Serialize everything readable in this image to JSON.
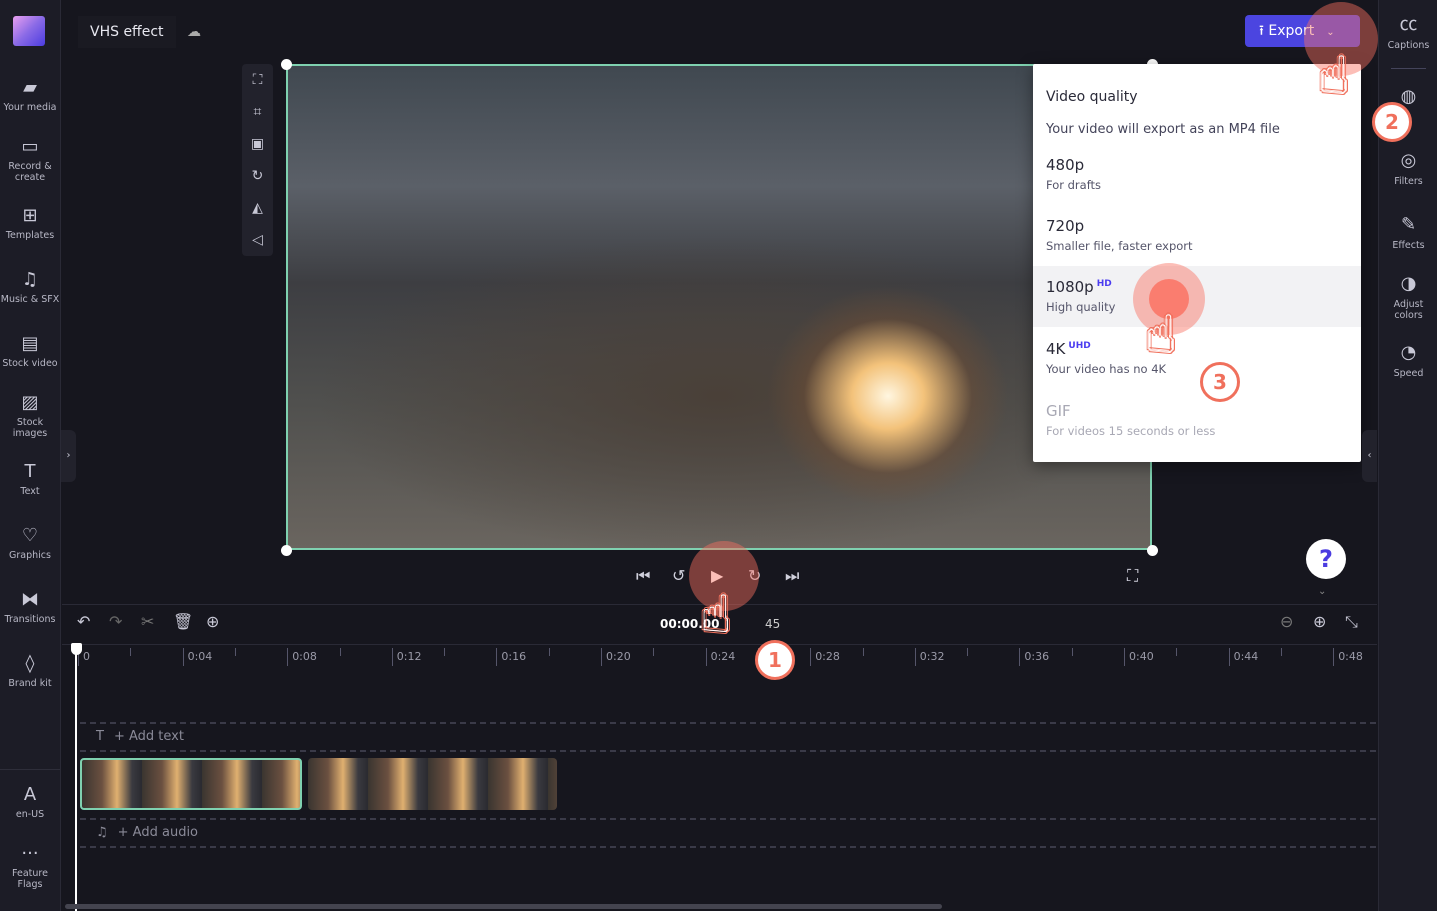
{
  "project": {
    "title": "VHS effect",
    "cloud_icon": "cloud-off-icon"
  },
  "sidebar": {
    "items": [
      {
        "label": "Your media",
        "icon": "folder-icon"
      },
      {
        "label": "Record & create",
        "icon": "camera-icon"
      },
      {
        "label": "Templates",
        "icon": "templates-icon"
      },
      {
        "label": "Music & SFX",
        "icon": "music-icon"
      },
      {
        "label": "Stock video",
        "icon": "film-icon"
      },
      {
        "label": "Stock images",
        "icon": "image-icon"
      },
      {
        "label": "Text",
        "icon": "text-icon"
      },
      {
        "label": "Graphics",
        "icon": "shapes-icon"
      },
      {
        "label": "Transitions",
        "icon": "transitions-icon"
      },
      {
        "label": "Brand kit",
        "icon": "brand-kit-icon"
      }
    ],
    "bottom": [
      {
        "label": "en-US",
        "icon": "language-icon"
      },
      {
        "label": "Feature Flags",
        "icon": "more-icon"
      }
    ]
  },
  "rightbar": {
    "items": [
      {
        "label": "Captions",
        "icon": "cc-icon"
      },
      {
        "label": "",
        "icon": "fade-icon"
      },
      {
        "label": "Filters",
        "icon": "filters-icon"
      },
      {
        "label": "Effects",
        "icon": "magic-wand-icon"
      },
      {
        "label": "Adjust colors",
        "icon": "adjust-colors-icon"
      },
      {
        "label": "Speed",
        "icon": "speedometer-icon"
      }
    ]
  },
  "export": {
    "label": "Export",
    "color": "#4b45e0"
  },
  "menu": {
    "title": "Video quality",
    "subtitle": "Your video will export as an MP4 file",
    "options": [
      {
        "label": "480p",
        "badge": "",
        "desc": "For drafts",
        "enabled": true
      },
      {
        "label": "720p",
        "badge": "",
        "desc": "Smaller file, faster export",
        "enabled": true
      },
      {
        "label": "1080p",
        "badge": "HD",
        "desc": "High quality",
        "enabled": true,
        "hovered": true
      },
      {
        "label": "4K",
        "badge": "UHD",
        "desc": "Your video has no 4K",
        "enabled": true
      },
      {
        "label": "GIF",
        "badge": "",
        "desc": "For videos 15 seconds or less",
        "enabled": false
      }
    ]
  },
  "playback": {
    "time_current": "00:00.00",
    "time_total_partial": "45"
  },
  "timeline": {
    "ticks": [
      "0",
      "0:04",
      "0:08",
      "0:12",
      "0:16",
      "0:20",
      "0:24",
      "0:28",
      "0:32",
      "0:36",
      "0:40",
      "0:44",
      "0:48"
    ],
    "add_text": "+ Add text",
    "add_audio": "+ Add audio"
  },
  "annotations": [
    "1",
    "2",
    "3"
  ],
  "help": "?"
}
